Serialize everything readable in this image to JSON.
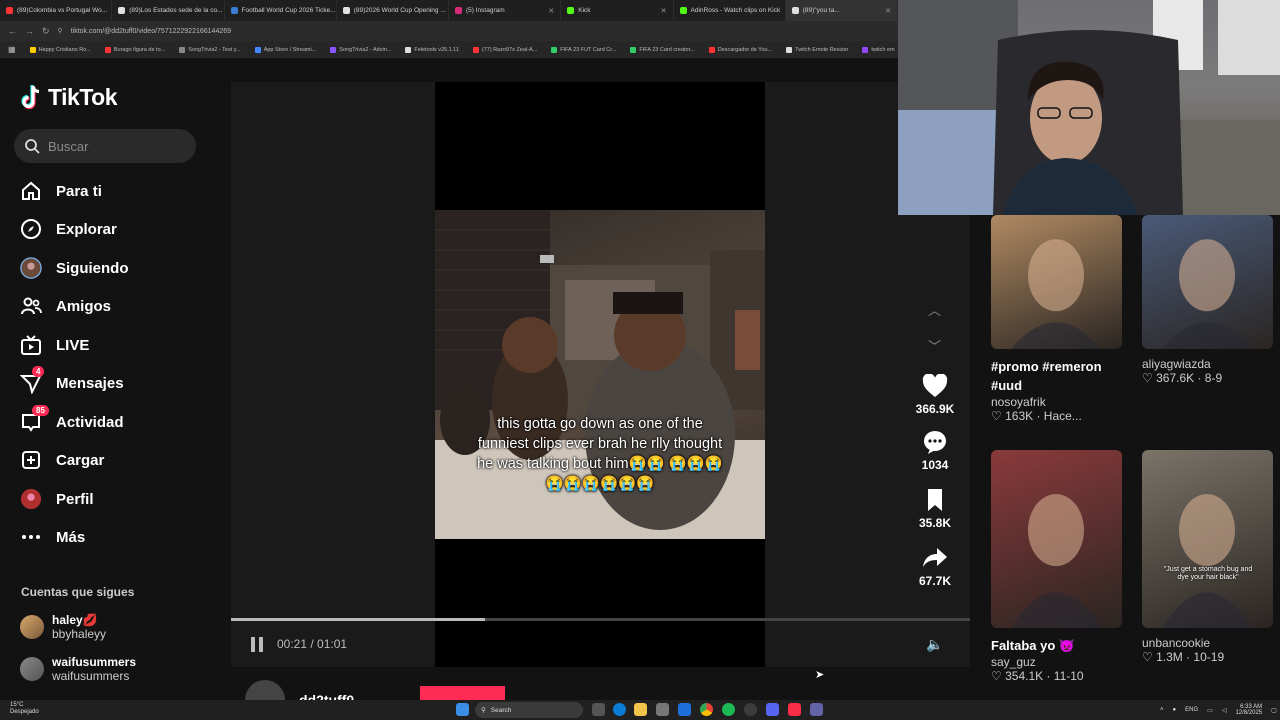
{
  "browser": {
    "tabs": [
      {
        "label": "(89)Colombia vs Portugal Wo...",
        "color": "#ff3333"
      },
      {
        "label": "(89)Los Estados sede de la co...",
        "color": "#e0e0e0"
      },
      {
        "label": "Football World Cup 2026 Ticke...",
        "color": "#3a7bd5"
      },
      {
        "label": "(89)2026 World Cup Opening ...",
        "color": "#e0e0e0"
      },
      {
        "label": "(5) Instagram",
        "color": "#d62976"
      },
      {
        "label": "Kick",
        "color": "#53fc18"
      },
      {
        "label": "AdinRoss - Watch clips on Kick",
        "color": "#53fc18"
      },
      {
        "label": "(89)\"you ta...",
        "color": "#e0e0e0"
      }
    ],
    "url": "tiktok.com/@dd2tuff0/video/7571222922166144269",
    "bookmarks": [
      {
        "label": "Happy Cristiano Ro...",
        "color": "#ffcc00"
      },
      {
        "label": "Burago figura de to...",
        "color": "#ff3333"
      },
      {
        "label": "SongTrivia2 - Test y...",
        "color": "#888888"
      },
      {
        "label": "App Store / Streami...",
        "color": "#4488ff"
      },
      {
        "label": "SongTrivia2 - Advin...",
        "color": "#8855ff"
      },
      {
        "label": "Feletools v25.1.11",
        "color": "#dddddd"
      },
      {
        "label": "(77) Razo97s Zeal-A...",
        "color": "#ff3333"
      },
      {
        "label": "FIFA 23 FUT Card Cr...",
        "color": "#33cc66"
      },
      {
        "label": "FIFA 23 Card creator...",
        "color": "#33cc66"
      },
      {
        "label": "Descargador de You...",
        "color": "#ff3333"
      },
      {
        "label": "Twitch Emote Resizer",
        "color": "#dddddd"
      },
      {
        "label": "twitch em",
        "color": "#9146ff"
      }
    ]
  },
  "sidebar": {
    "logo": "TikTok",
    "search_placeholder": "Buscar",
    "items": [
      {
        "label": "Para ti",
        "icon": "home-icon"
      },
      {
        "label": "Explorar",
        "icon": "compass-icon"
      },
      {
        "label": "Siguiendo",
        "icon": "following-avatar-icon"
      },
      {
        "label": "Amigos",
        "icon": "friends-icon"
      },
      {
        "label": "LIVE",
        "icon": "live-tv-icon"
      },
      {
        "label": "Mensajes",
        "icon": "send-icon",
        "badge": "4"
      },
      {
        "label": "Actividad",
        "icon": "inbox-icon",
        "badge": "85"
      },
      {
        "label": "Cargar",
        "icon": "upload-plus-icon"
      },
      {
        "label": "Perfil",
        "icon": "profile-avatar-icon"
      },
      {
        "label": "Más",
        "icon": "more-dots-icon"
      }
    ],
    "following_title": "Cuentas que sigues",
    "following": [
      {
        "name": "haley💋",
        "handle": "bbyhaleyy"
      },
      {
        "name": "waifusummers",
        "handle": "waifusummers"
      }
    ]
  },
  "video": {
    "caption": "this gotta go down as one of the funniest clips ever brah he rlly thought he was talking bout him😭😭 😭😭😭😭😭😭😭😭😭",
    "current_time": "00:21",
    "duration": "01:01",
    "progress": 0.344,
    "author": "dd2tuff0"
  },
  "actions": {
    "likes": "366.9K",
    "comments": "1034",
    "saves": "35.8K",
    "shares": "67.7K"
  },
  "related": [
    {
      "title": "#promo #remeron #uud",
      "user": "nosoyafrik",
      "stat": "163K · Hace...",
      "thumb": "#b08a62"
    },
    {
      "title": "",
      "user": "aliyagwiazda",
      "stat": "367.6K · 8-9",
      "thumb": "#4a5a78"
    },
    {
      "title": "Faltaba yo 👿",
      "user": "say_guz",
      "stat": "354.1K · 11-10",
      "thumb": "#8a3a3a"
    },
    {
      "title": "",
      "user": "unbancookie",
      "stat": "1.3M · 10-19",
      "thumb": "#7a7368",
      "overlay": "\"Just get a stomach bug and dye your hair black\""
    }
  ],
  "taskbar": {
    "temp": "15°C",
    "weather": "Despejado",
    "search": "Search",
    "lang": "ENG",
    "time": "6:33 AM",
    "date": "12/8/2025"
  }
}
